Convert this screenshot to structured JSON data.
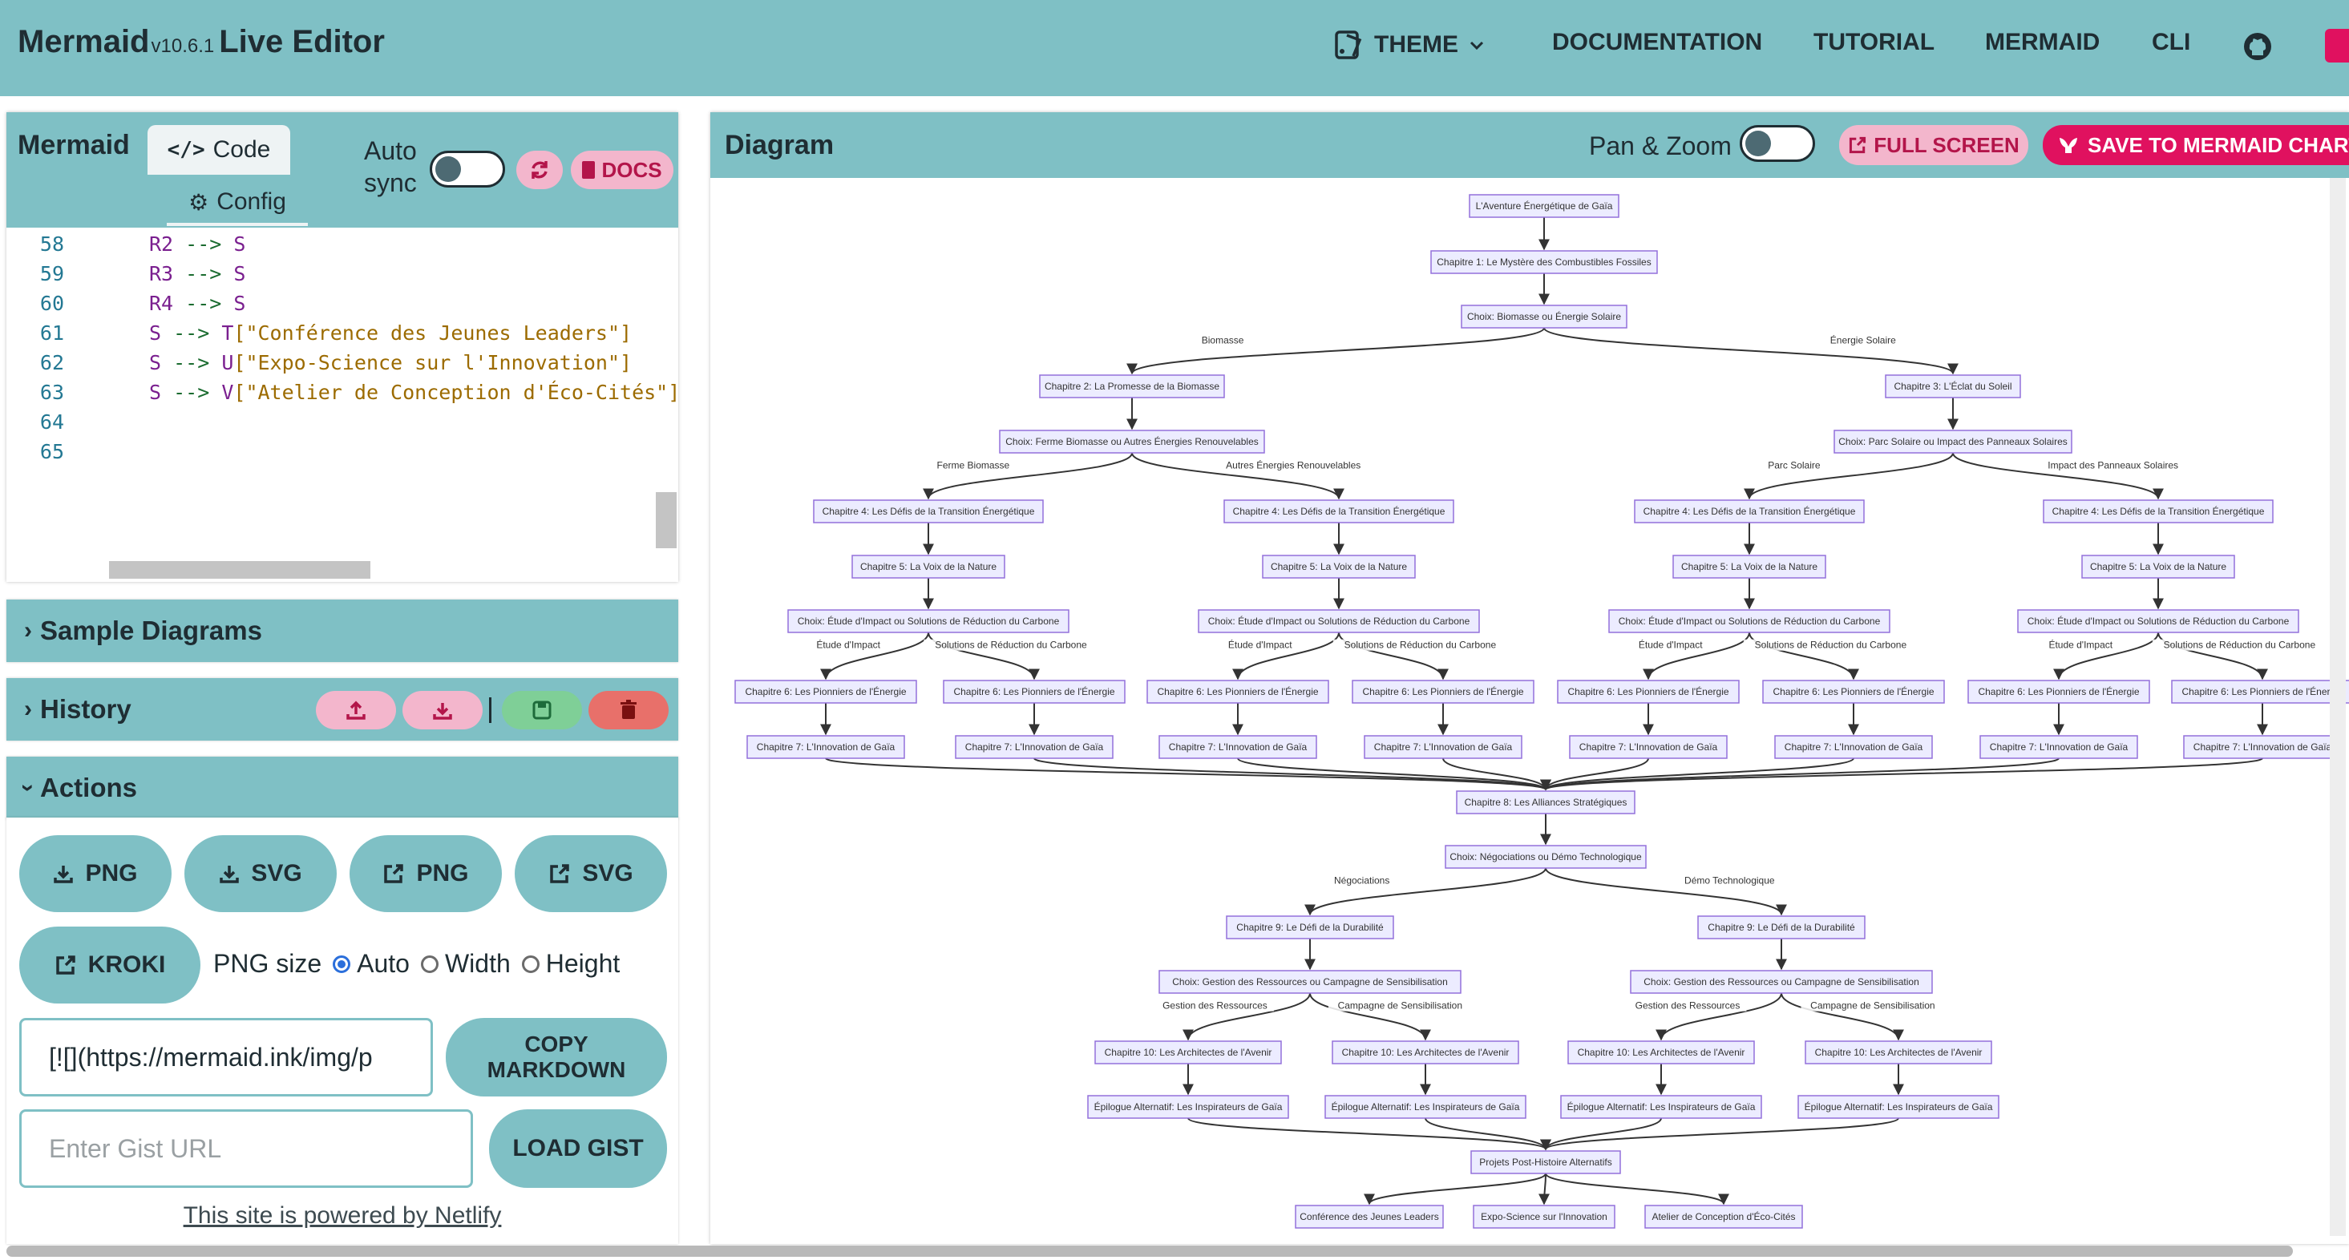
{
  "app": {
    "name": "Mermaid",
    "version": "v10.6.1",
    "title_suffix": "Live Editor"
  },
  "nav": {
    "theme": "THEME",
    "documentation": "DOCUMENTATION",
    "tutorial": "TUTORIAL",
    "mermaid": "MERMAID",
    "cli": "CLI"
  },
  "editor": {
    "title": "Mermaid",
    "tab_code": "Code",
    "tab_config": "Config",
    "auto_sync_1": "Auto",
    "auto_sync_2": "sync",
    "auto_sync_on": false,
    "docs": "DOCS",
    "lines": [
      {
        "n": "58",
        "t": "R2 --> S"
      },
      {
        "n": "59",
        "t": "R3 --> S"
      },
      {
        "n": "60",
        "t": "R4 --> S"
      },
      {
        "n": "61",
        "t": "S --> T[\"Conférence des Jeunes Leaders\"]"
      },
      {
        "n": "62",
        "t": "S --> U[\"Expo-Science sur l'Innovation\"]"
      },
      {
        "n": "63",
        "t": "S --> V[\"Atelier de Conception d'Éco-Cités\"]"
      },
      {
        "n": "64",
        "t": ""
      },
      {
        "n": "65",
        "t": ""
      }
    ]
  },
  "sections": {
    "sample": "Sample Diagrams",
    "history": "History",
    "actions": "Actions"
  },
  "actions": {
    "png": "PNG",
    "svg": "SVG",
    "kroki": "KROKI",
    "png_size": "PNG size",
    "auto": "Auto",
    "width": "Width",
    "height": "Height",
    "markdown_value": "[![](https://mermaid.ink/img/p",
    "copy_markdown_1": "COPY",
    "copy_markdown_2": "MARKDOWN",
    "gist_placeholder": "Enter Gist URL",
    "load_gist": "LOAD GIST",
    "footer": "This site is powered by Netlify"
  },
  "diagram": {
    "title": "Diagram",
    "pan_zoom": "Pan & Zoom",
    "pan_zoom_on": false,
    "full_screen": "FULL SCREEN",
    "save": "SAVE TO MERMAID CHART",
    "nodes": {
      "root": "L'Aventure Énergétique de Gaïa",
      "ch1": "Chapitre 1: Le Mystère des Combustibles Fossiles",
      "c1": "Choix: Biomasse ou Énergie Solaire",
      "ch2": "Chapitre 2: La Promesse de la Biomasse",
      "ch3": "Chapitre 3: L'Éclat du Soleil",
      "cbio": "Choix: Ferme Biomasse ou Autres Énergies Renouvelables",
      "csol": "Choix: Parc Solaire ou Impact des Panneaux Solaires",
      "ch4": "Chapitre 4: Les Défis de la Transition Énergétique",
      "ch5": "Chapitre 5: La Voix de la Nature",
      "c5": "Choix: Étude d'Impact ou Solutions de Réduction du Carbone",
      "ch6": "Chapitre 6: Les Pionniers de l'Énergie",
      "ch7": "Chapitre 7: L'Innovation de Gaïa",
      "ch8": "Chapitre 8: Les Alliances Stratégiques",
      "c8": "Choix: Négociations ou Démo Technologique",
      "ch9": "Chapitre 9: Le Défi de la Durabilité",
      "c9": "Choix: Gestion des Ressources ou Campagne de Sensibilisation",
      "ch10": "Chapitre 10: Les Architectes de l'Avenir",
      "epi": "Épilogue Alternatif: Les Inspirateurs de Gaïa",
      "proj": "Projets Post-Histoire Alternatifs",
      "t": "Conférence des Jeunes Leaders",
      "u": "Expo-Science sur l'Innovation",
      "v": "Atelier de Conception d'Éco-Cités"
    },
    "edge_labels": {
      "biomasse": "Biomasse",
      "solaire": "Énergie Solaire",
      "ferme": "Ferme Biomasse",
      "autres": "Autres Énergies Renouvelables",
      "parc": "Parc Solaire",
      "impact_panneaux": "Impact des Panneaux Solaires",
      "etude": "Étude d'Impact",
      "solutions": "Solutions de Réduction du Carbone",
      "nego": "Négociations",
      "demo": "Démo Technologique",
      "gestion": "Gestion des Ressources",
      "campagne": "Campagne de Sensibilisation"
    }
  },
  "colors": {
    "accent": "#7fc0c5",
    "node_fill": "#ececff",
    "node_stroke": "#9370db",
    "pink": "#f3b6cc",
    "green": "#7fcf97",
    "red": "#e8706a"
  }
}
